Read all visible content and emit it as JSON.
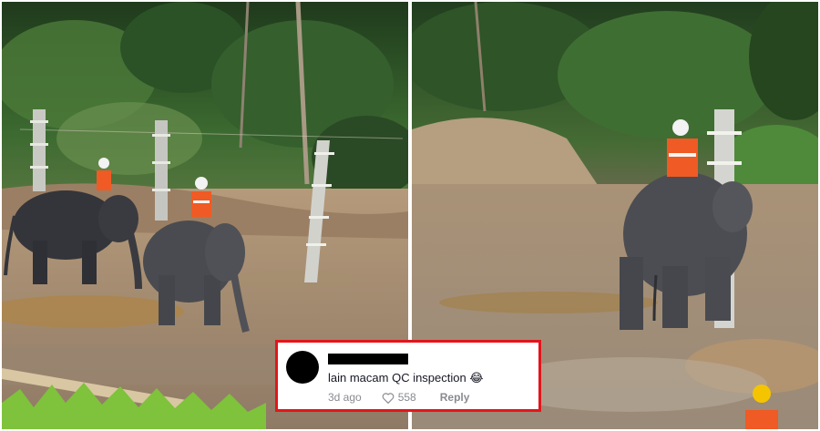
{
  "comment": {
    "text": "lain macam QC inspection 😂",
    "time": "3d ago",
    "likes": "558",
    "reply_label": "Reply",
    "icons": [
      "avatar-redacted",
      "heart-icon"
    ]
  },
  "colors": {
    "comment_border": "#e3151b",
    "vest_orange": "#f05a24",
    "foliage": "#2f5a2a"
  }
}
